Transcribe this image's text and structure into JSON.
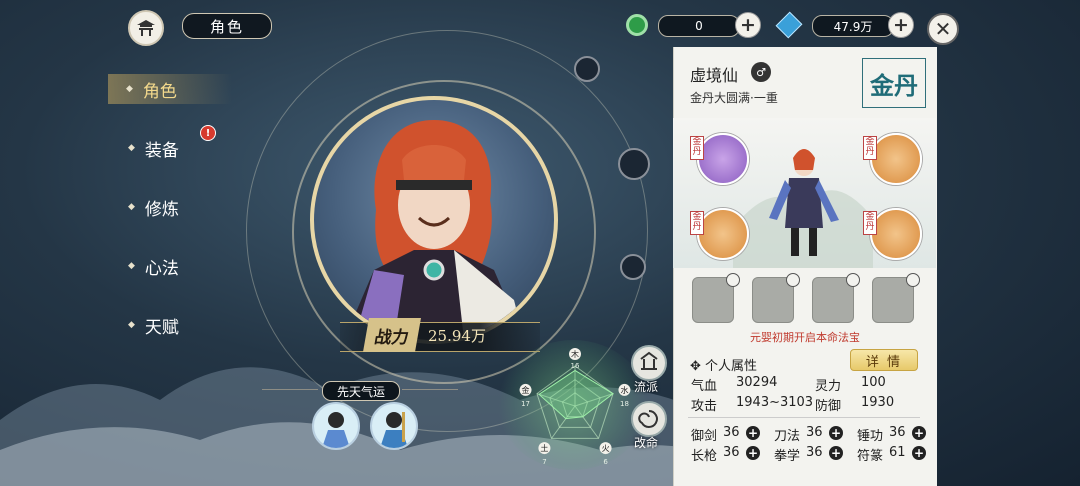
{
  "header": {
    "title": "角色"
  },
  "resources": [
    {
      "icon": "jade-ring-icon",
      "value": "0",
      "color": "#2e9c48"
    },
    {
      "icon": "spirit-crystal-icon",
      "value": "47.9万",
      "color": "#3aa0d9"
    }
  ],
  "nav": {
    "items": [
      {
        "label": "角色",
        "active": true
      },
      {
        "label": "装备",
        "badge": "!"
      },
      {
        "label": "修炼"
      },
      {
        "label": "心法"
      },
      {
        "label": "天赋"
      }
    ]
  },
  "power": {
    "label": "战力",
    "value": "25.94万"
  },
  "fortune": {
    "label": "先天气运"
  },
  "radar": {
    "axes": [
      {
        "label": "木",
        "value": "16"
      },
      {
        "label": "水",
        "value": "18"
      },
      {
        "label": "火",
        "value": "6"
      },
      {
        "label": "土",
        "value": "7"
      },
      {
        "label": "金",
        "value": "17"
      }
    ],
    "max": 18
  },
  "side_buttons": [
    {
      "label": "流派"
    },
    {
      "label": "改命"
    }
  ],
  "character": {
    "name": "虚境仙",
    "realm": "金丹大圆满·一重",
    "stamp": "金丹",
    "treasure_tag": "金丹",
    "slot_hint": "元婴初期开启本命法宝"
  },
  "attributes": {
    "title": "个人属性",
    "detail_label": "详 情",
    "stats": [
      {
        "label": "气血",
        "value": "30294"
      },
      {
        "label": "灵力",
        "value": "100"
      },
      {
        "label": "攻击",
        "value": "1943~3103"
      },
      {
        "label": "防御",
        "value": "1930"
      }
    ],
    "skills": [
      {
        "label": "御剑",
        "value": "36"
      },
      {
        "label": "刀法",
        "value": "36"
      },
      {
        "label": "锤功",
        "value": "36"
      },
      {
        "label": "长枪",
        "value": "36"
      },
      {
        "label": "拳学",
        "value": "36"
      },
      {
        "label": "符篆",
        "value": "61"
      }
    ]
  },
  "colors": {
    "accent_gold": "#e7c96a",
    "hint_red": "#c03a2e",
    "panel_bg": "#f3f3ef"
  }
}
